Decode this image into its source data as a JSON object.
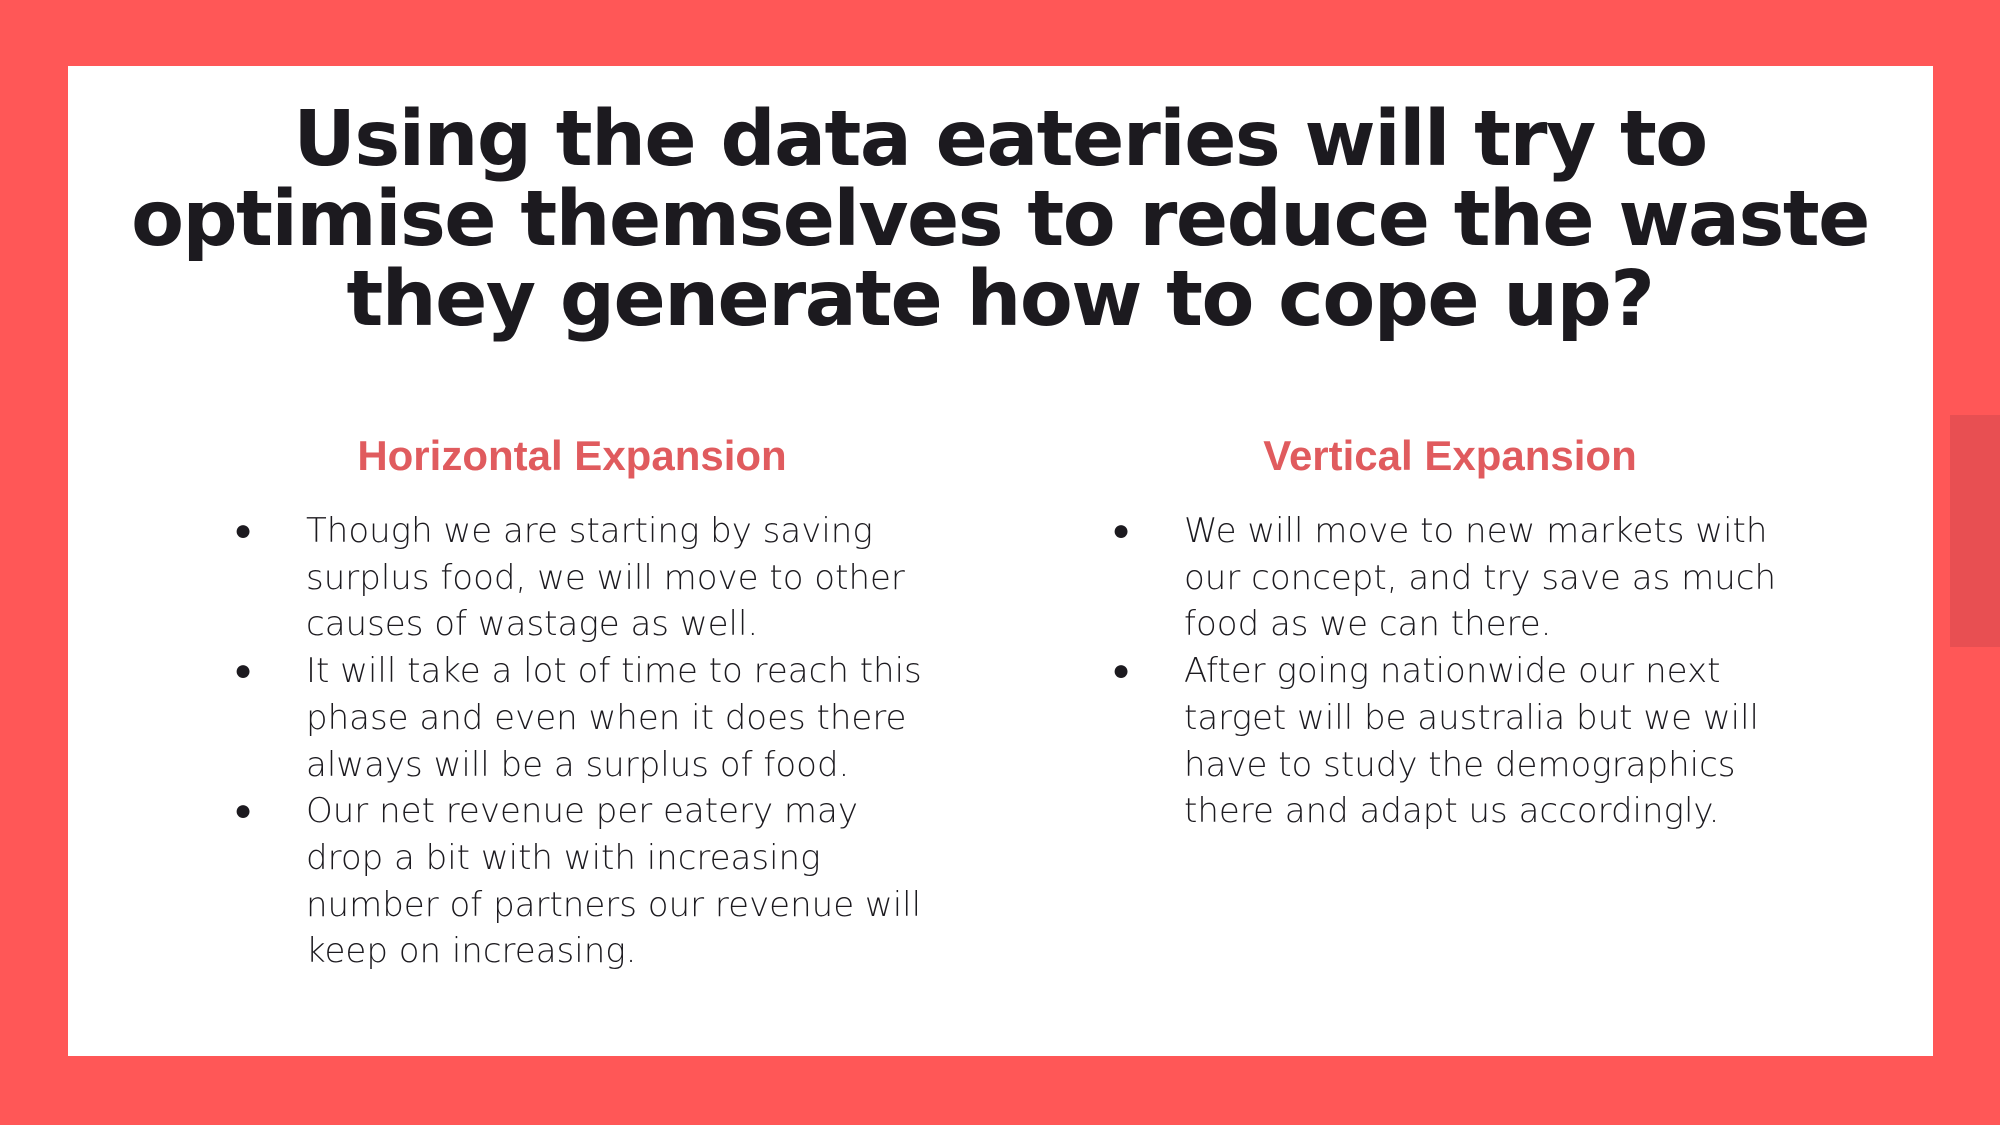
{
  "slide": {
    "title": "Using the data eateries will try to optimise themselves to reduce the waste they generate how to cope up?",
    "left_column": {
      "heading": "Horizontal Expansion",
      "bullets": [
        "Though we are starting by saving surplus food, we will move to other causes of wastage as well.",
        "It will take a lot of time to reach this phase and even when it does there always will be a surplus of food.",
        "Our net revenue per eatery may drop a bit with with increasing number of partners our revenue will keep on increasing."
      ]
    },
    "right_column": {
      "heading": "Vertical Expansion",
      "bullets": [
        "We will move to new markets with our concept, and try save as much food as we can there.",
        "After going nationwide our next target will be australia but we will have to study the demographics there and adapt us accordingly."
      ]
    },
    "bullet_glyph": "●",
    "colors": {
      "frame": "#ff5757",
      "heading_accent": "#e05b5e",
      "text": "#1c1a1f",
      "card": "#ffffff"
    }
  }
}
